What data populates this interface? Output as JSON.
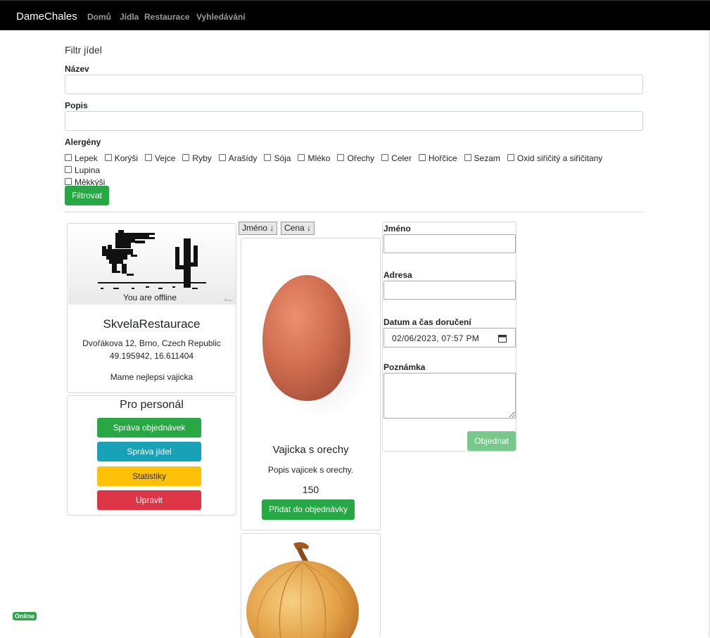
{
  "navbar": {
    "brand": "DameChales",
    "links": [
      "Domů",
      "Jídla",
      "Restaurace",
      "Vyhledávání"
    ]
  },
  "filter": {
    "title": "Filtr jídel",
    "name_label": "Název",
    "name_value": "",
    "description_label": "Popis",
    "description_value": "",
    "allergens_label": "Alergény",
    "allergens": [
      "Lepek",
      "Korýši",
      "Vejce",
      "Ryby",
      "Arašídy",
      "Sója",
      "Mléko",
      "Ořechy",
      "Celer",
      "Hořčice",
      "Sezam",
      "Oxid siřičitý a siřičitany",
      "Lupina",
      "Měkkýši"
    ],
    "submit_label": "Filtrovat"
  },
  "restaurant": {
    "image_caption": "You are offline",
    "name": "SkvelaRestaurace",
    "address": "Dvořákova 12, Brno, Czech Republic",
    "coordinates": "49.195942, 16.611404",
    "description": "Mame nejlepsi vajicka"
  },
  "staff": {
    "title": "Pro personál",
    "buttons": [
      "Správa objednávek",
      "Správa jídel",
      "Statistiky",
      "Upravit"
    ]
  },
  "sort": {
    "by_name": "Jméno ↓",
    "by_price": "Cena ↓"
  },
  "foods": [
    {
      "name": "Vajicka s orechy",
      "description": "Popis vajicek s orechy.",
      "price": "150",
      "add_label": "Přidat do objednávky"
    }
  ],
  "order": {
    "name_label": "Jméno",
    "name_value": "",
    "address_label": "Adresa",
    "address_value": "",
    "datetime_label": "Datum a čas doručení",
    "datetime_value": "02/06/2023, 07:57 PM",
    "note_label": "Poznámka",
    "note_value": "",
    "submit_label": "Objednat"
  },
  "status_badge": "Online",
  "colors": {
    "success": "#28a745",
    "info": "#17a2b8",
    "warning": "#ffc107",
    "danger": "#dc3545",
    "navbar": "#000000"
  }
}
